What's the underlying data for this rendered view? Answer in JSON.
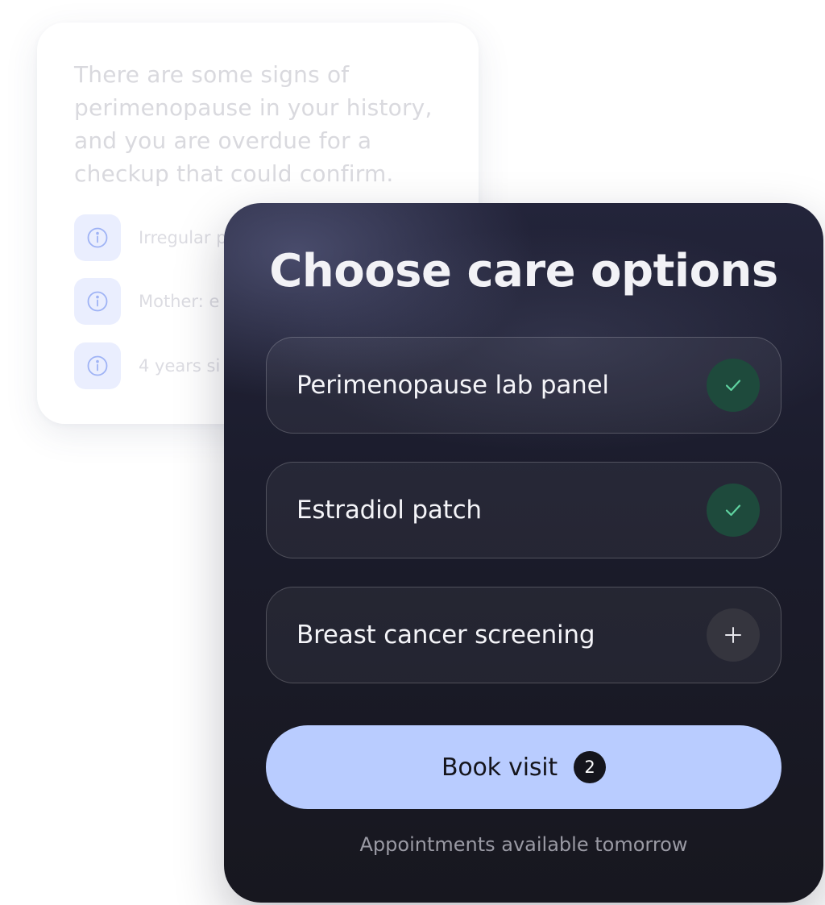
{
  "background_card": {
    "summary": "There are some signs of perimenopause in your history, and you are overdue for a checkup that could confirm.",
    "items": [
      {
        "icon": "info-icon",
        "label": "Irregular p"
      },
      {
        "icon": "info-icon",
        "label": "Mother: e"
      },
      {
        "icon": "info-icon",
        "label": "4 years si"
      }
    ]
  },
  "care_panel": {
    "title": "Choose care options",
    "options": [
      {
        "label": "Perimenopause lab panel",
        "state": "selected",
        "icon": "check-icon"
      },
      {
        "label": "Estradiol patch",
        "state": "selected",
        "icon": "check-icon"
      },
      {
        "label": "Breast cancer screening",
        "state": "not-selected",
        "icon": "plus-icon"
      }
    ],
    "book_button": {
      "label": "Book visit",
      "count": "2"
    },
    "availability": "Appointments available tomorrow"
  },
  "colors": {
    "panel_dark": "#1b1c2c",
    "button_accent": "#b9ccff",
    "check_green": "#5fd3a0",
    "check_bg": "#1e4a3c",
    "info_blue": "#9fb3f5"
  }
}
